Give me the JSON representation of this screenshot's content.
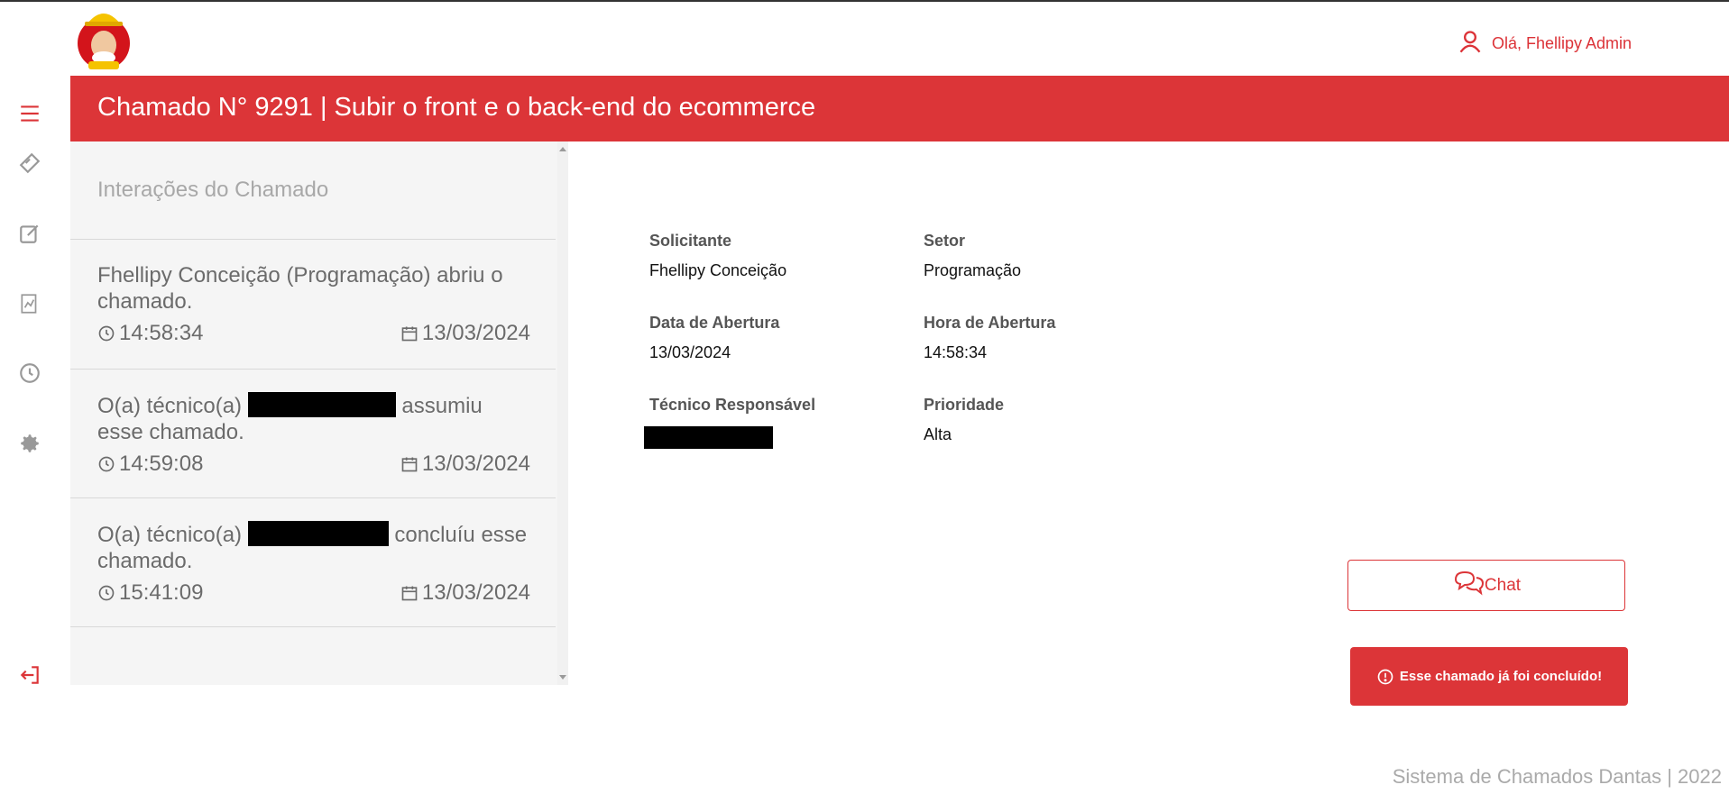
{
  "header": {
    "user_greeting": "Olá, Fhellipy Admin",
    "title": "Chamado N° 9291 | Subir o front e o back-end do ecommerce"
  },
  "sidebar": {
    "items": [
      {
        "icon": "menu-icon"
      },
      {
        "icon": "ticket-icon"
      },
      {
        "icon": "edit-icon"
      },
      {
        "icon": "report-icon"
      },
      {
        "icon": "history-icon"
      },
      {
        "icon": "gear-icon"
      },
      {
        "icon": "logout-icon"
      }
    ]
  },
  "interactions": {
    "title": "Interações do Chamado",
    "items": [
      {
        "text": "Fhellipy Conceição (Programação) abriu o chamado.",
        "time": "14:58:34",
        "date": "13/03/2024"
      },
      {
        "prefix": "O(a) técnico(a)",
        "suffix": "assumiu esse chamado.",
        "time": "14:59:08",
        "date": "13/03/2024"
      },
      {
        "prefix": "O(a) técnico(a)",
        "suffix": "concluíu esse chamado.",
        "time": "15:41:09",
        "date": "13/03/2024"
      }
    ]
  },
  "details": {
    "solicitante_label": "Solicitante",
    "solicitante_value": "Fhellipy Conceição",
    "setor_label": "Setor",
    "setor_value": "Programação",
    "data_label": "Data de Abertura",
    "data_value": "13/03/2024",
    "hora_label": "Hora de Abertura",
    "hora_value": "14:58:34",
    "tecnico_label": "Técnico Responsável",
    "prioridade_label": "Prioridade",
    "prioridade_value": "Alta"
  },
  "actions": {
    "chat_label": "Chat",
    "alert_text": "Esse chamado já foi concluído!"
  },
  "footer": {
    "text": "Sistema de Chamados Dantas | 2022"
  },
  "colors": {
    "accent": "#dc3538"
  }
}
